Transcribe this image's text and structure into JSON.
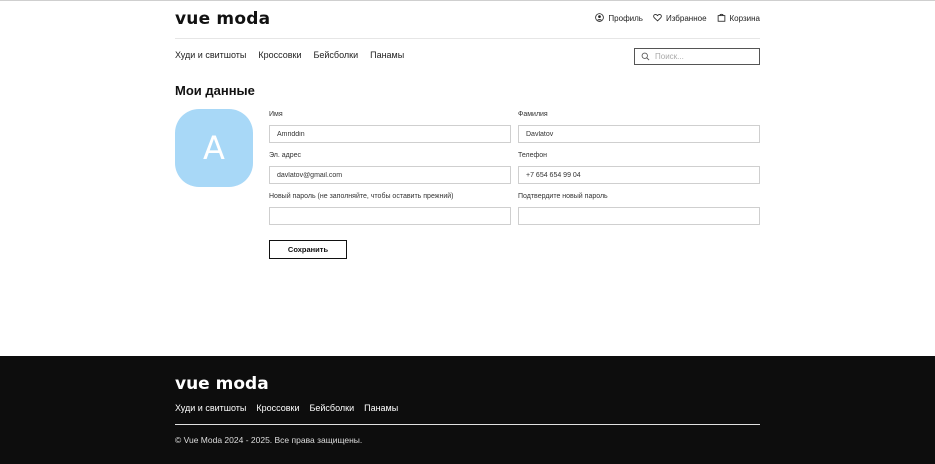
{
  "header": {
    "logo": "vue moda",
    "actions": [
      {
        "label": "Профиль",
        "icon": "user-circle-icon"
      },
      {
        "label": "Избранное",
        "icon": "heart-icon"
      },
      {
        "label": "Корзина",
        "icon": "bag-icon"
      }
    ]
  },
  "nav": {
    "items": [
      "Худи и свитшоты",
      "Кроссовки",
      "Бейсболки",
      "Панамы"
    ]
  },
  "search": {
    "placeholder": "Поиск...",
    "icon": "search-icon"
  },
  "page": {
    "title": "Мои данные"
  },
  "avatar": {
    "initial": "A",
    "color": "#a8d8f7"
  },
  "form": {
    "first_name": {
      "label": "Имя",
      "value": "Amriddin"
    },
    "last_name": {
      "label": "Фамилия",
      "value": "Davlatov"
    },
    "email": {
      "label": "Эл. адрес",
      "value": "davlatov@gmail.com"
    },
    "phone": {
      "label": "Телефон",
      "value": "+7 654 654 99 04"
    },
    "new_password": {
      "label": "Новый пароль (не заполняйте, чтобы оставить прежний)",
      "value": ""
    },
    "confirm_password": {
      "label": "Подтвердите новый пароль",
      "value": ""
    },
    "save_label": "Сохранить"
  },
  "footer": {
    "logo": "vue moda",
    "nav": [
      "Худи и свитшоты",
      "Кроссовки",
      "Бейсболки",
      "Панамы"
    ],
    "copyright": "© Vue Moda 2024 - 2025. Все права защищены.",
    "background": "#0d0d0d"
  }
}
